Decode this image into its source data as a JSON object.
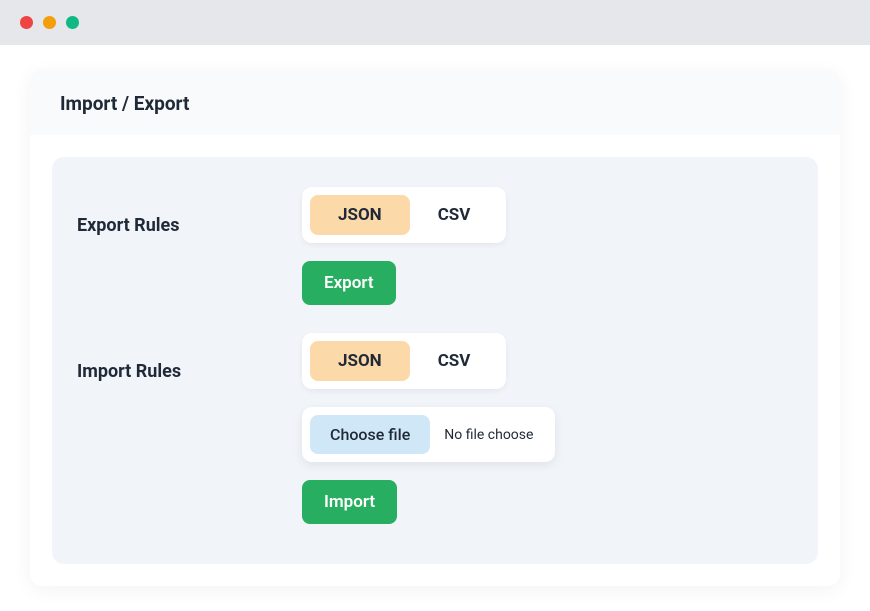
{
  "card": {
    "title": "Import / Export"
  },
  "export": {
    "label": "Export Rules",
    "options": {
      "json": "JSON",
      "csv": "CSV"
    },
    "button": "Export"
  },
  "import": {
    "label": "Import Rules",
    "options": {
      "json": "JSON",
      "csv": "CSV"
    },
    "choose_file": "Choose file",
    "file_status": "No file choose",
    "button": "Import"
  }
}
